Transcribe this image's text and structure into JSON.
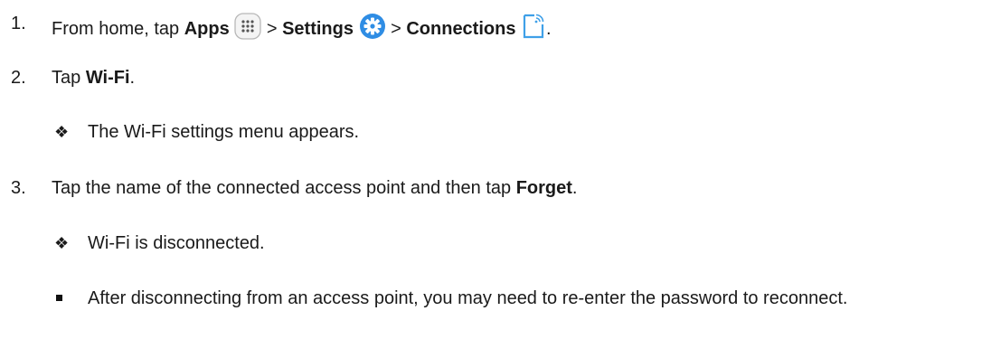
{
  "steps": [
    {
      "number": "1.",
      "prefix": "From home, tap ",
      "apps": "Apps",
      "sep1": " > ",
      "settings": "Settings",
      "sep2": " > ",
      "connections": "Connections",
      "suffix": "."
    },
    {
      "number": "2.",
      "prefix": "Tap ",
      "bold": "Wi-Fi",
      "suffix": ".",
      "result": "The Wi-Fi settings menu appears."
    },
    {
      "number": "3.",
      "prefix": "Tap the name of the connected access point and then tap ",
      "bold": "Forget",
      "suffix": ".",
      "result": "Wi-Fi is disconnected.",
      "note": "After disconnecting from an access point, you may need to re-enter the password to reconnect."
    }
  ],
  "bullet_symbol": "❖",
  "icons": {
    "apps": "apps-grid-icon",
    "settings": "settings-gear-icon",
    "connections": "connections-icon",
    "settings_color": "#2f8de4",
    "connections_color": "#3fa0e8"
  }
}
